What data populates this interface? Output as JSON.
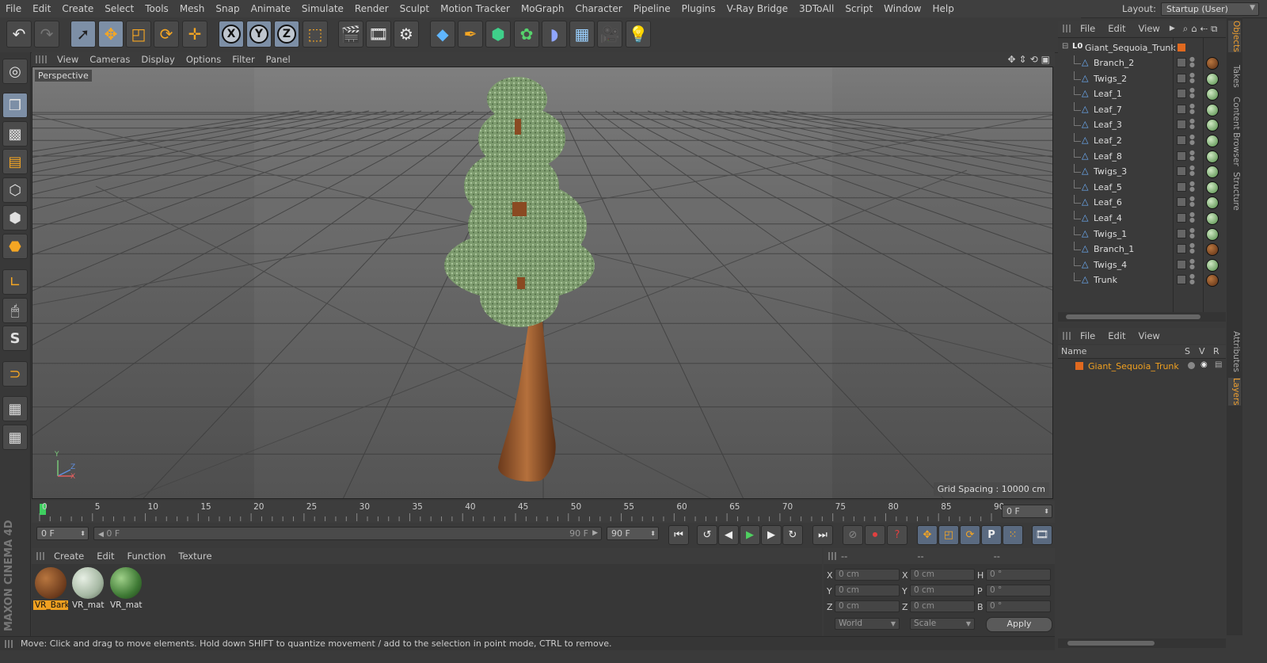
{
  "menubar": {
    "items": [
      "File",
      "Edit",
      "Create",
      "Select",
      "Tools",
      "Mesh",
      "Snap",
      "Animate",
      "Simulate",
      "Render",
      "Sculpt",
      "Motion Tracker",
      "MoGraph",
      "Character",
      "Pipeline",
      "Plugins",
      "V-Ray Bridge",
      "3DToAll",
      "Script",
      "Window",
      "Help"
    ],
    "layout_label": "Layout:",
    "layout_value": "Startup (User)"
  },
  "toolbar": {
    "axis_x": "X",
    "axis_y": "Y",
    "axis_z": "Z"
  },
  "viewport": {
    "menu": [
      "View",
      "Cameras",
      "Display",
      "Options",
      "Filter",
      "Panel"
    ],
    "label": "Perspective",
    "grid_spacing": "Grid Spacing : 10000 cm",
    "axis_y": "Y",
    "axis_z": "Z",
    "axis_x": "X"
  },
  "timeline": {
    "ticks": [
      "0",
      "5",
      "10",
      "15",
      "20",
      "25",
      "30",
      "35",
      "40",
      "45",
      "50",
      "55",
      "60",
      "65",
      "70",
      "75",
      "80",
      "85",
      "90"
    ],
    "current_frame": "0 F",
    "start_frame": "0 F",
    "range_start": "0 F",
    "range_end": "90 F",
    "end_frame": "90 F"
  },
  "material_manager": {
    "menu": [
      "Create",
      "Edit",
      "Function",
      "Texture"
    ],
    "materials": [
      {
        "name": "VR_Bark",
        "selected": true
      },
      {
        "name": "VR_mat",
        "selected": false
      },
      {
        "name": "VR_mat",
        "selected": false
      }
    ]
  },
  "coordinates": {
    "headers": [
      "--",
      "--",
      "--"
    ],
    "rows": [
      {
        "a": "X",
        "av": "0 cm",
        "b": "X",
        "bv": "0 cm",
        "c": "H",
        "cv": "0 °"
      },
      {
        "a": "Y",
        "av": "0 cm",
        "b": "Y",
        "bv": "0 cm",
        "c": "P",
        "cv": "0 °"
      },
      {
        "a": "Z",
        "av": "0 cm",
        "b": "Z",
        "bv": "0 cm",
        "c": "B",
        "cv": "0 °"
      }
    ],
    "mode": "World",
    "scale": "Scale",
    "apply": "Apply"
  },
  "status": {
    "text": "Move: Click and drag to move elements. Hold down SHIFT to quantize movement / add to the selection in point mode, CTRL to remove."
  },
  "object_manager": {
    "menu": [
      "File",
      "Edit",
      "View"
    ],
    "root": "Giant_Sequoia_Trunk",
    "objects": [
      {
        "name": "Branch_2",
        "tag": "bark"
      },
      {
        "name": "Twigs_2",
        "tag": "leaf"
      },
      {
        "name": "Leaf_1",
        "tag": "leaf"
      },
      {
        "name": "Leaf_7",
        "tag": "leaf"
      },
      {
        "name": "Leaf_3",
        "tag": "leaf"
      },
      {
        "name": "Leaf_2",
        "tag": "leaf"
      },
      {
        "name": "Leaf_8",
        "tag": "leaf"
      },
      {
        "name": "Twigs_3",
        "tag": "leaf"
      },
      {
        "name": "Leaf_5",
        "tag": "leaf"
      },
      {
        "name": "Leaf_6",
        "tag": "leaf"
      },
      {
        "name": "Leaf_4",
        "tag": "leaf"
      },
      {
        "name": "Twigs_1",
        "tag": "leaf"
      },
      {
        "name": "Branch_1",
        "tag": "bark"
      },
      {
        "name": "Twigs_4",
        "tag": "leaf"
      },
      {
        "name": "Trunk",
        "tag": "bark"
      }
    ]
  },
  "layer_manager": {
    "menu": [
      "File",
      "Edit",
      "View"
    ],
    "col_name": "Name",
    "col_s": "S",
    "col_v": "V",
    "col_r": "R",
    "layers": [
      "Giant_Sequoia_Trunk"
    ]
  },
  "right_tabs": [
    "Objects",
    "Takes",
    "Content Browser",
    "Structure",
    "Attributes",
    "Layers"
  ],
  "brand": "MAXON CINEMA 4D",
  "colors": {
    "accent": "#f0a020",
    "selection": "#7d8fa6",
    "layer": "#e0691f"
  }
}
